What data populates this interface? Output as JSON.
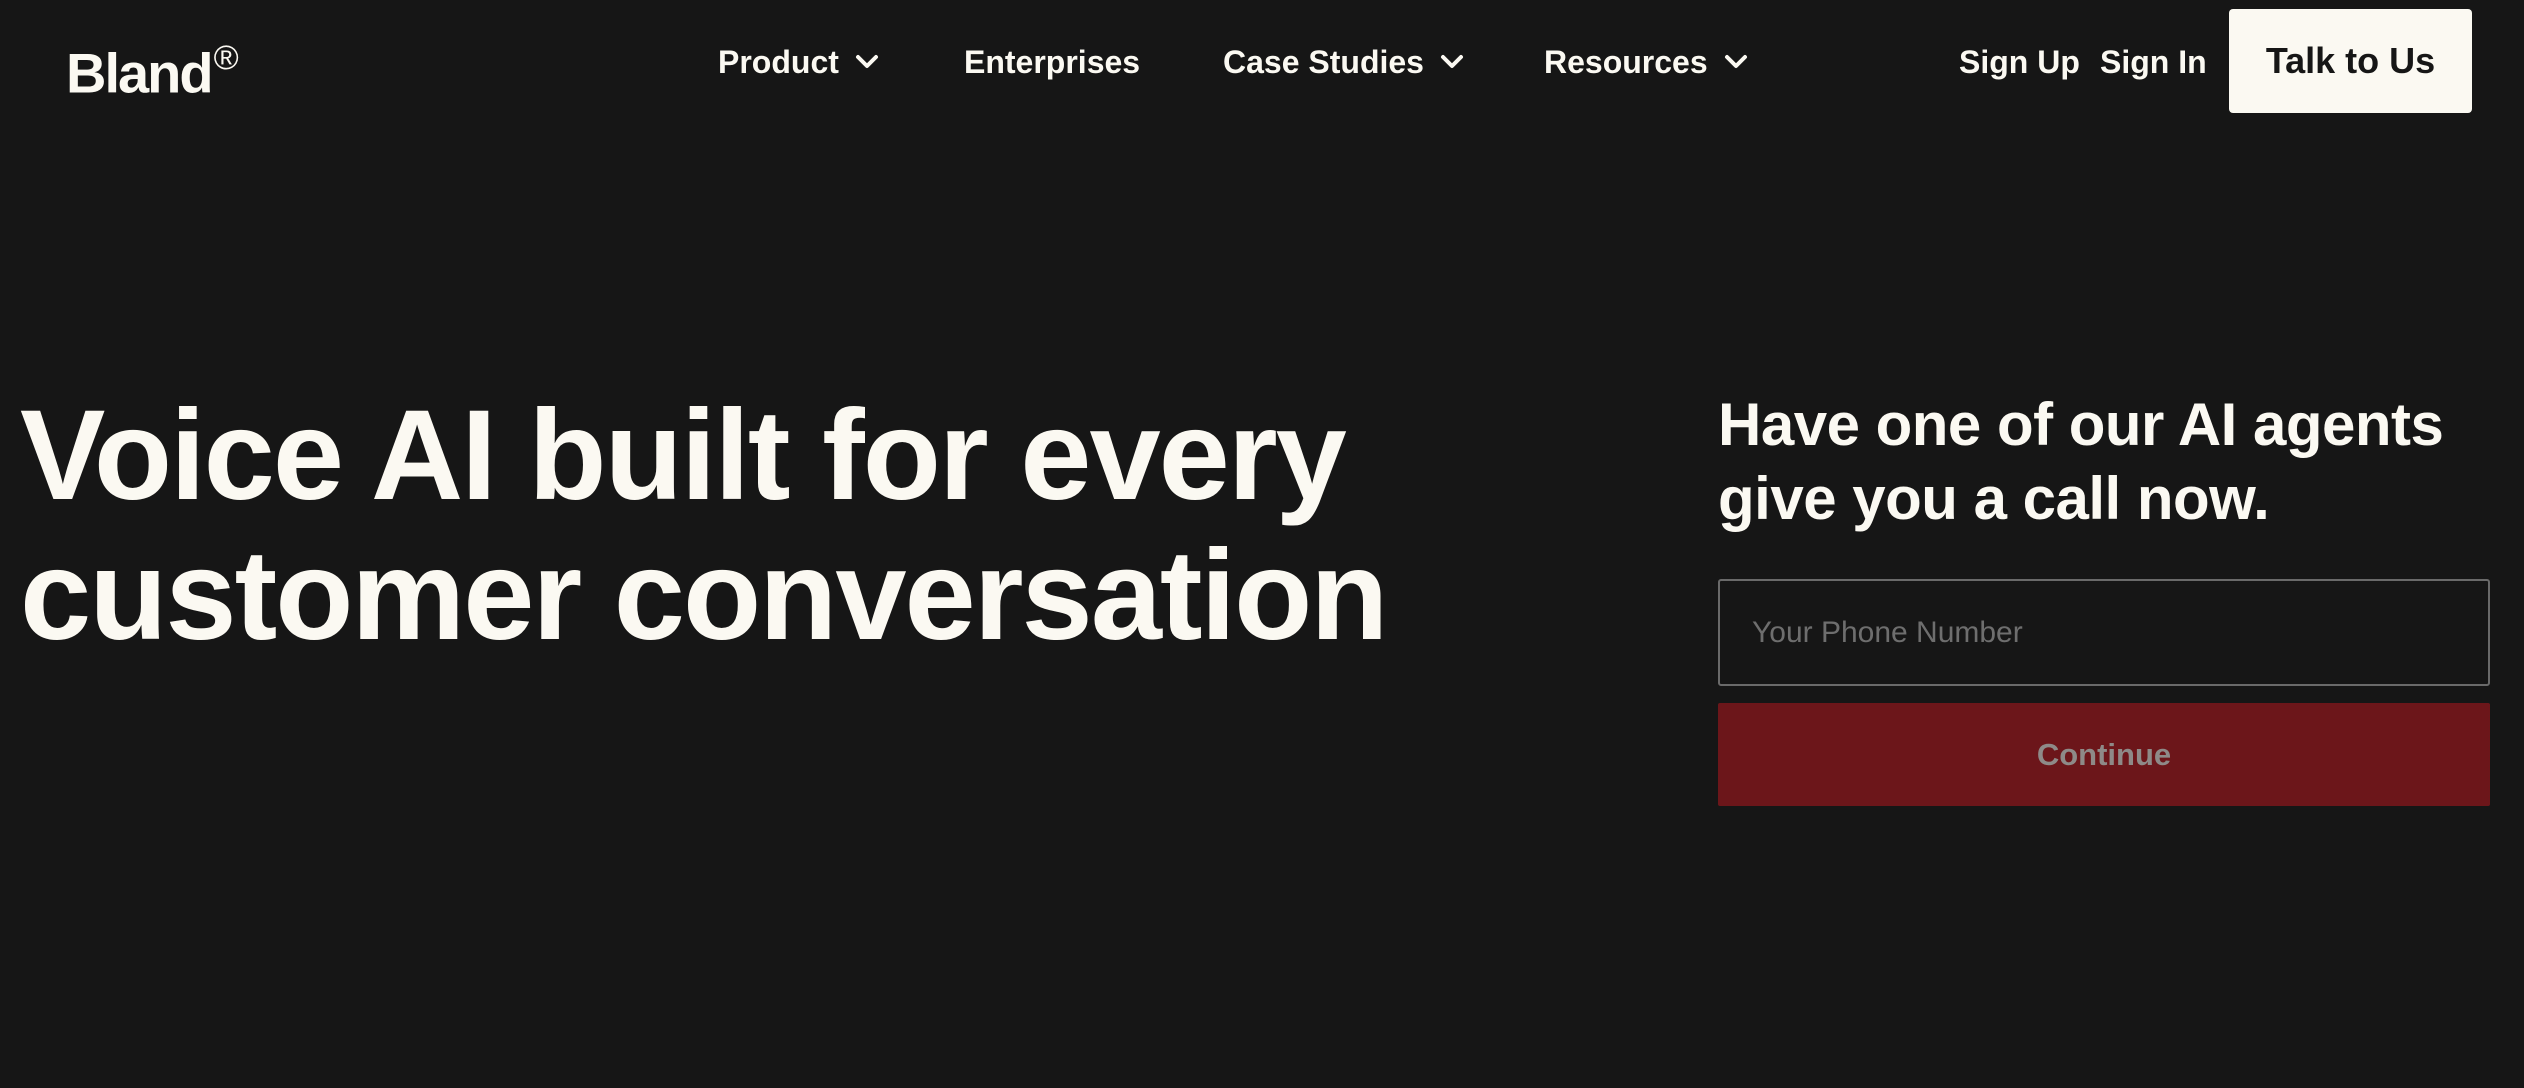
{
  "brand": {
    "name": "Bland",
    "mark": "®"
  },
  "nav": {
    "items": [
      {
        "label": "Product",
        "has_dropdown": true,
        "icon": "chevron-down-icon"
      },
      {
        "label": "Enterprises",
        "has_dropdown": false
      },
      {
        "label": "Case Studies",
        "has_dropdown": true,
        "icon": "chevron-down-icon"
      },
      {
        "label": "Resources",
        "has_dropdown": true,
        "icon": "chevron-down-icon"
      }
    ],
    "sign_up": "Sign Up",
    "sign_in": "Sign In",
    "cta": "Talk to Us"
  },
  "hero": {
    "title_line1": "Voice AI built for every",
    "title_line2": "customer conversation"
  },
  "call_form": {
    "heading_line1": "Have one of our AI agents",
    "heading_line2": "give you a call now.",
    "phone_placeholder": "Your Phone Number",
    "phone_value": "",
    "submit_label": "Continue"
  },
  "colors": {
    "background": "#161616",
    "text": "#fbf9f2",
    "cta_background": "#fbf9f2",
    "submit_background": "#6c161a",
    "submit_text_disabled": "#8e8a88",
    "input_border": "#6a6a6a",
    "placeholder": "#6e6e6e"
  }
}
